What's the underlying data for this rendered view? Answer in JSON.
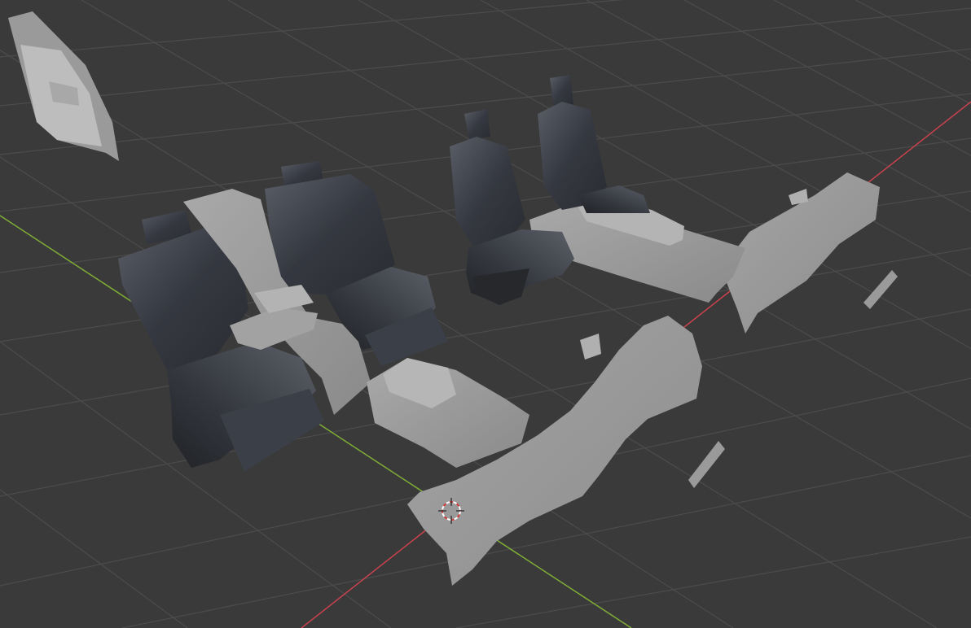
{
  "app": {
    "name": "",
    "view": "3D Viewport"
  },
  "viewport": {
    "background_color": "#3a3a3a",
    "grid_color": "#4d4d4d",
    "x_axis_color": "#c9424e",
    "y_axis_color": "#7fae36",
    "leather_color": "#3d4048",
    "plastic_color": "#9c9c9c"
  },
  "scene_objects": [
    {
      "id": "door-panel",
      "label": ""
    },
    {
      "id": "rear-bench-seat",
      "label": ""
    },
    {
      "id": "front-left-seat",
      "label": ""
    },
    {
      "id": "front-right-seat",
      "label": ""
    },
    {
      "id": "center-console-rear",
      "label": ""
    },
    {
      "id": "center-console-front",
      "label": ""
    },
    {
      "id": "floor-carpet-front",
      "label": ""
    },
    {
      "id": "floor-carpet-rear",
      "label": ""
    },
    {
      "id": "trim-strip-1",
      "label": ""
    },
    {
      "id": "trim-strip-2",
      "label": ""
    }
  ],
  "cursor": {
    "icon": "3d-cursor-icon"
  }
}
